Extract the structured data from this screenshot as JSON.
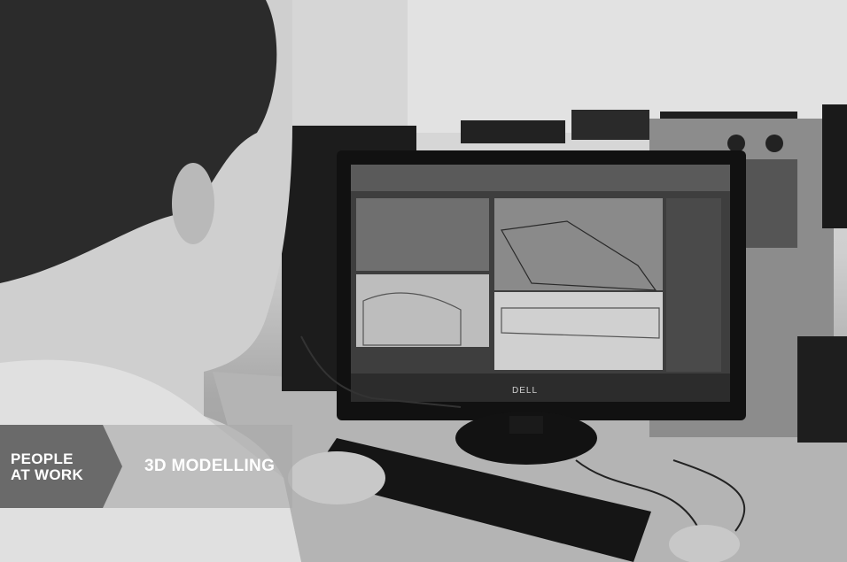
{
  "caption": {
    "tag_line1": "PEOPLE",
    "tag_line2": "AT WORK",
    "topic": "3D MODELLING"
  },
  "monitor": {
    "brand": "DELL"
  },
  "colors": {
    "banner_tag": "#6a6a6a",
    "banner_overlay": "#aaaaaa",
    "text": "#ffffff"
  }
}
